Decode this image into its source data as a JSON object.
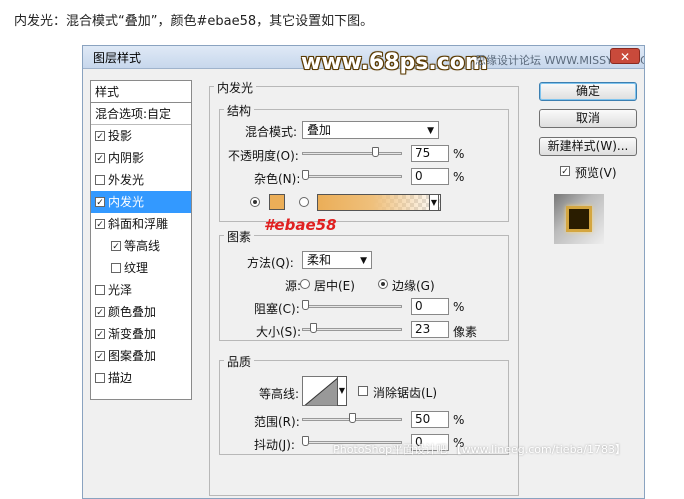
{
  "caption": "内发光：混合模式“叠加”，颜色#ebae58，其它设置如下图。",
  "dialog": {
    "title": "图层样式",
    "close_label": "✕",
    "watermark": "www.68ps.com",
    "watermark2": "思缘设计论坛  WWW.MISSYUAN.COM",
    "footer": "PhotoShop平面设计吧 【www.lineeg.com/tieba/1783】"
  },
  "style_list": {
    "header": "样式",
    "blend_options": "混合选项:自定",
    "items": [
      {
        "label": "投影",
        "checked": true,
        "indent": false,
        "selected": false
      },
      {
        "label": "内阴影",
        "checked": true,
        "indent": false,
        "selected": false
      },
      {
        "label": "外发光",
        "checked": false,
        "indent": false,
        "selected": false
      },
      {
        "label": "内发光",
        "checked": true,
        "indent": false,
        "selected": true
      },
      {
        "label": "斜面和浮雕",
        "checked": true,
        "indent": false,
        "selected": false
      },
      {
        "label": "等高线",
        "checked": true,
        "indent": true,
        "selected": false
      },
      {
        "label": "纹理",
        "checked": false,
        "indent": true,
        "selected": false
      },
      {
        "label": "光泽",
        "checked": false,
        "indent": false,
        "selected": false
      },
      {
        "label": "颜色叠加",
        "checked": true,
        "indent": false,
        "selected": false
      },
      {
        "label": "渐变叠加",
        "checked": true,
        "indent": false,
        "selected": false
      },
      {
        "label": "图案叠加",
        "checked": true,
        "indent": false,
        "selected": false
      },
      {
        "label": "描边",
        "checked": false,
        "indent": false,
        "selected": false
      }
    ]
  },
  "panel": {
    "title": "内发光",
    "structure": {
      "label": "结构",
      "blend_mode_label": "混合模式:",
      "blend_mode_value": "叠加",
      "opacity_label": "不透明度(O):",
      "opacity_value": "75",
      "opacity_fraction": 0.75,
      "noise_label": "杂色(N):",
      "noise_value": "0",
      "noise_fraction": 0.0,
      "percent": "%",
      "glow_color": "#ebae58",
      "annotation": "#ebae58"
    },
    "elements": {
      "label": "图素",
      "technique_label": "方法(Q):",
      "technique_value": "柔和",
      "source_label": "源:",
      "source_center": "居中(E)",
      "source_edge": "边缘(G)",
      "choke_label": "阻塞(C):",
      "choke_value": "0",
      "choke_fraction": 0.0,
      "size_label": "大小(S):",
      "size_value": "23",
      "size_fraction": 0.09,
      "size_unit": "像素",
      "percent": "%"
    },
    "quality": {
      "label": "品质",
      "contour_label": "等高线:",
      "antialias_label": "消除锯齿(L)",
      "range_label": "范围(R):",
      "range_value": "50",
      "range_fraction": 0.5,
      "jitter_label": "抖动(J):",
      "jitter_value": "0",
      "jitter_fraction": 0.0,
      "percent": "%"
    }
  },
  "buttons": {
    "ok": "确定",
    "cancel": "取消",
    "new_style": "新建样式(W)...",
    "preview_label": "预览(V)",
    "preview_checked": true
  }
}
